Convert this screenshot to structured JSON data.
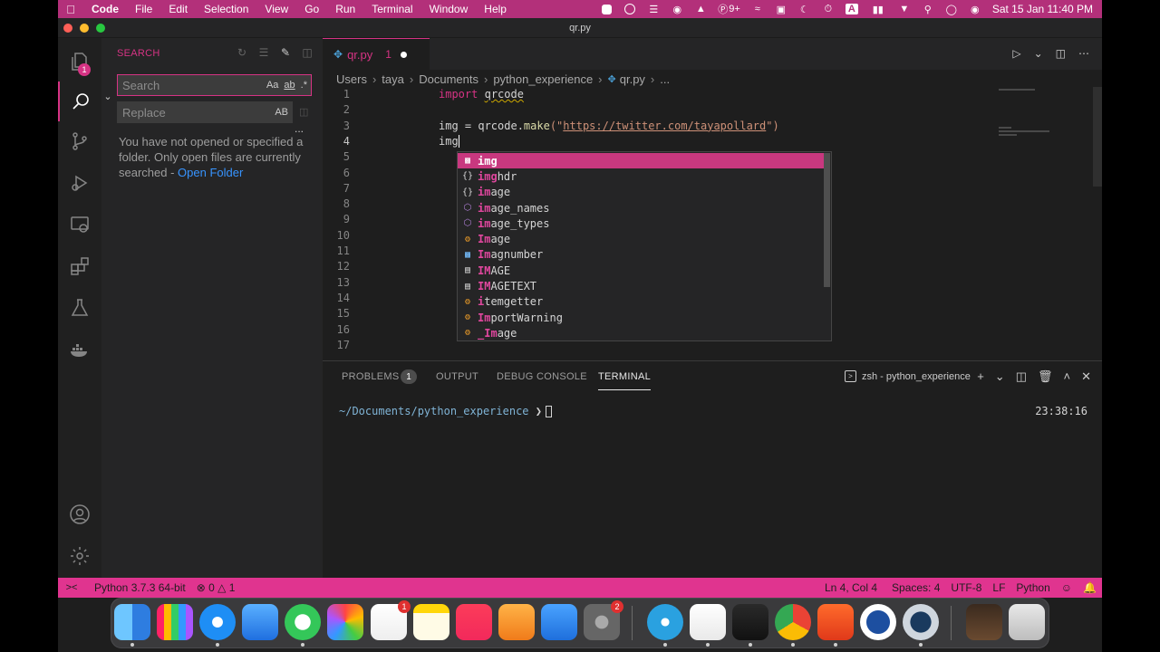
{
  "menubar": {
    "app": "Code",
    "items": [
      "File",
      "Edit",
      "Selection",
      "View",
      "Go",
      "Run",
      "Terminal",
      "Window",
      "Help"
    ],
    "status_icons": [
      "record-icon",
      "circle-icon",
      "sliders-icon",
      "eye-icon",
      "game-icon",
      "p-badge-icon",
      "wifi-icon",
      "display-icon",
      "moon-icon",
      "timer-icon",
      "text-input-icon",
      "battery-icon",
      "wifi-signal-icon",
      "search-icon",
      "control-center-icon",
      "siri-icon"
    ],
    "p_badge": "9+",
    "text_input": "A",
    "clock": "Sat 15 Jan  11:40 PM"
  },
  "window": {
    "title": "qr.py"
  },
  "activity": {
    "explorer_badge": "1"
  },
  "sidebar": {
    "title": "SEARCH",
    "search_placeholder": "Search",
    "search_opts": [
      "Aa",
      "ab",
      ".*"
    ],
    "replace_placeholder": "Replace",
    "replace_opt": "AB",
    "more": "...",
    "message": "You have not opened or specified a folder. Only open files are currently searched - ",
    "link": "Open Folder"
  },
  "editor": {
    "tab": {
      "name": "qr.py",
      "problems": "1"
    },
    "breadcrumb": [
      "Users",
      "taya",
      "Documents",
      "python_experience",
      "qr.py",
      "..."
    ],
    "line_numbers": [
      "1",
      "2",
      "3",
      "4",
      "5",
      "6",
      "7",
      "8",
      "9",
      "10",
      "11",
      "12",
      "13",
      "14",
      "15",
      "16",
      "17"
    ],
    "code": {
      "l1_kw": "import",
      "l1_mod": "qrcode",
      "l3_var": "img = qrcode.",
      "l3_fn": "make",
      "l3_open": "(\"",
      "l3_url": "https://twitter.com/tayapollard",
      "l3_close": "\")",
      "l4": "img"
    },
    "suggestions": [
      {
        "kind": "variable",
        "hl": "img",
        "rest": ""
      },
      {
        "kind": "module",
        "hl": "img",
        "rest": "hdr"
      },
      {
        "kind": "module",
        "hl": "im",
        "rest": "age"
      },
      {
        "kind": "value",
        "hl": "im",
        "rest": "age_names"
      },
      {
        "kind": "value",
        "hl": "im",
        "rest": "age_types"
      },
      {
        "kind": "class",
        "hl": "Im",
        "rest": "age"
      },
      {
        "kind": "variable",
        "hl": "Im",
        "rest": "agnumber"
      },
      {
        "kind": "text",
        "hl": "IM",
        "rest": "AGE"
      },
      {
        "kind": "text",
        "hl": "IM",
        "rest": "AGETEXT"
      },
      {
        "kind": "class",
        "hl": "i",
        "rest": "temgetter"
      },
      {
        "kind": "class",
        "hl": "Im",
        "rest": "portWarning"
      },
      {
        "kind": "class",
        "hl": "_Im",
        "rest": "age"
      }
    ]
  },
  "panel": {
    "tabs": [
      "PROBLEMS",
      "OUTPUT",
      "DEBUG CONSOLE",
      "TERMINAL"
    ],
    "problems_count": "1",
    "terminal_name": "zsh - python_experience",
    "prompt_path": "~/Documents/python_experience",
    "prompt_arrow": "❯",
    "time": "23:38:16"
  },
  "statusbar": {
    "python": "Python 3.7.3 64-bit",
    "errors": "0",
    "warnings": "1",
    "position": "Ln 4, Col 4",
    "spaces": "Spaces: 4",
    "encoding": "UTF-8",
    "eol": "LF",
    "language": "Python"
  },
  "dock": {
    "apps": [
      "finder-icon",
      "launchpad-icon",
      "safari-icon",
      "mail-icon",
      "messages-icon",
      "photos-icon",
      "reminders-icon",
      "notes-icon",
      "music-icon",
      "pages-icon",
      "keynote-icon",
      "system-preferences-icon",
      "telegram-icon",
      "vscode-icon",
      "terminal-icon",
      "chrome-icon",
      "brave-icon",
      "ledger-icon",
      "quicktime-icon",
      "folder-thumbnail-icon",
      "trash-icon"
    ],
    "reminders_badge": "1",
    "prefs_badge": "2"
  },
  "colors": {
    "accent": "#d63384",
    "statusbar": "#e0348f",
    "menubar": "#b3307a"
  }
}
